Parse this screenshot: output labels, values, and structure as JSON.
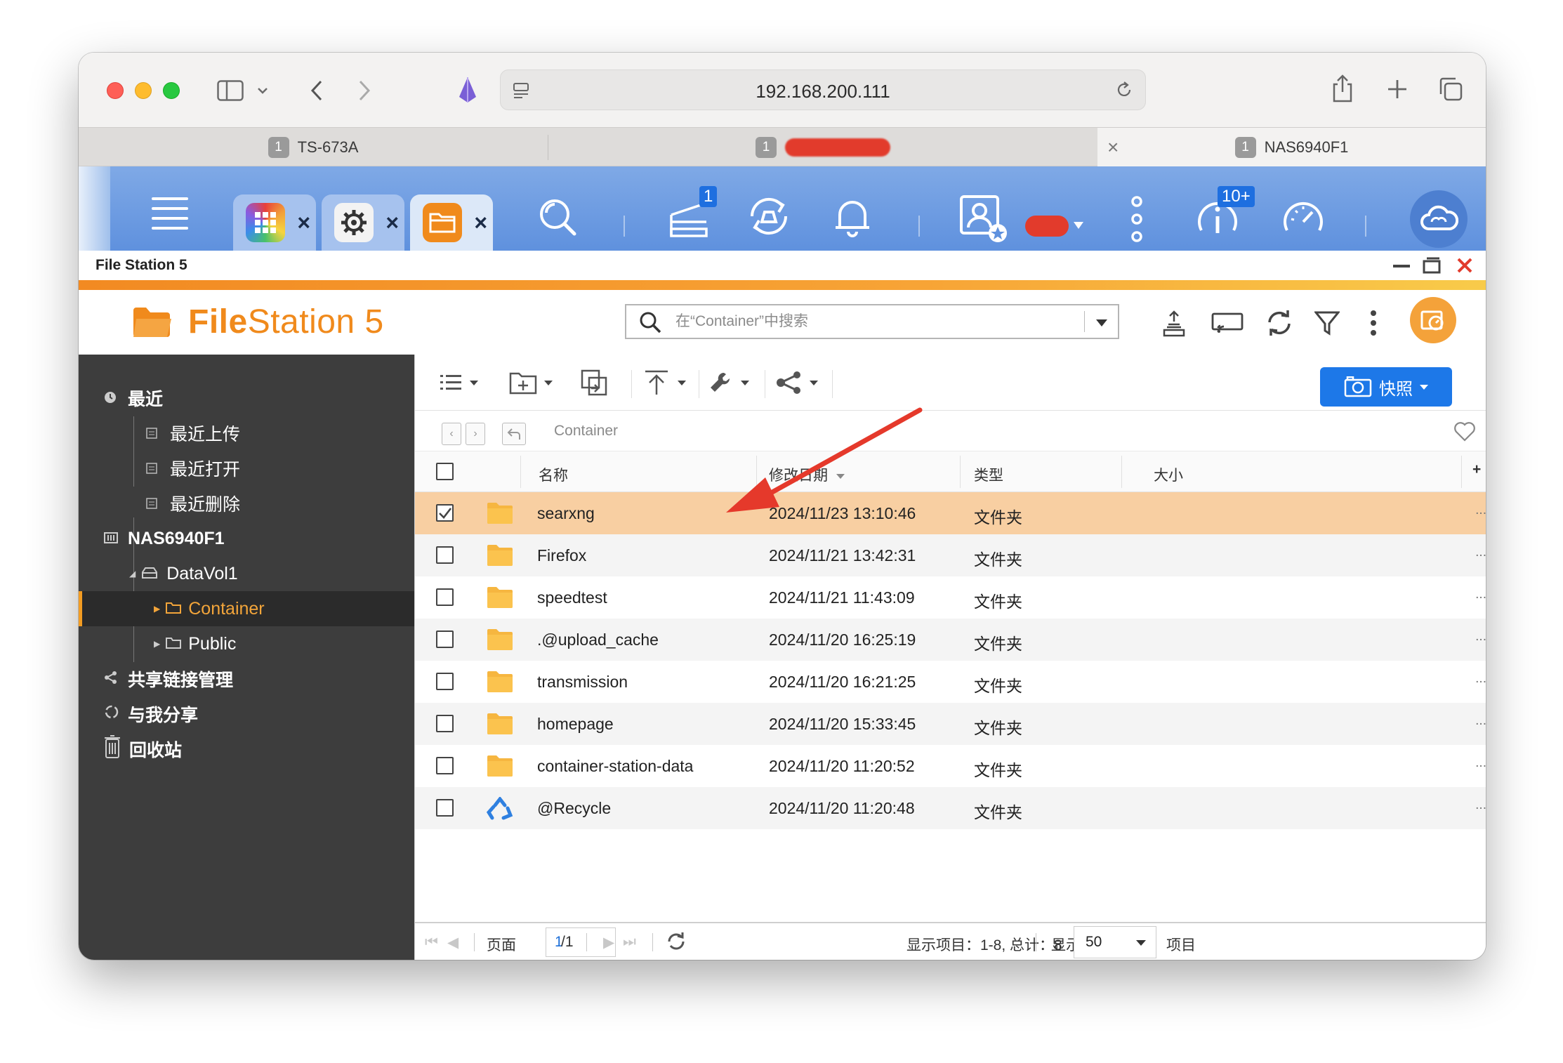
{
  "browser": {
    "address": "192.168.200.111",
    "tabs": [
      {
        "badge": "1",
        "label": "TS-673A"
      },
      {
        "badge": "1",
        "label": ""
      },
      {
        "badge": "1",
        "label": "NAS6940F1"
      }
    ],
    "tab_close": "×"
  },
  "qts": {
    "badge_tasks": "1",
    "badge_notifications": "10+"
  },
  "window": {
    "title": "File Station 5"
  },
  "app": {
    "logo_bold": "File",
    "logo_rest": "Station 5",
    "search_placeholder": "在“Container”中搜索",
    "snapshot_label": "快照"
  },
  "sidebar": {
    "recent": "最近",
    "recent_upload": "最近上传",
    "recent_open": "最近打开",
    "recent_delete": "最近删除",
    "nas": "NAS6940F1",
    "volume": "DataVol1",
    "folder_container": "Container",
    "folder_public": "Public",
    "share_links": "共享链接管理",
    "shared_with_me": "与我分享",
    "recycle_bin": "回收站"
  },
  "breadcrumb": {
    "path": "Container"
  },
  "table": {
    "columns": {
      "name": "名称",
      "modified": "修改日期",
      "type": "类型",
      "size": "大小",
      "add": "+"
    },
    "rows": [
      {
        "name": "searxng",
        "modified": "2024/11/23 13:10:46",
        "type": "文件夹",
        "more": "...",
        "checked": true
      },
      {
        "name": "Firefox",
        "modified": "2024/11/21 13:42:31",
        "type": "文件夹",
        "more": "..."
      },
      {
        "name": "speedtest",
        "modified": "2024/11/21 11:43:09",
        "type": "文件夹",
        "more": "..."
      },
      {
        "name": ".@upload_cache",
        "modified": "2024/11/20 16:25:19",
        "type": "文件夹",
        "more": "..."
      },
      {
        "name": "transmission",
        "modified": "2024/11/20 16:21:25",
        "type": "文件夹",
        "more": "..."
      },
      {
        "name": "homepage",
        "modified": "2024/11/20 15:33:45",
        "type": "文件夹",
        "more": "..."
      },
      {
        "name": "container-station-data",
        "modified": "2024/11/20 11:20:52",
        "type": "文件夹",
        "more": "..."
      },
      {
        "name": "@Recycle",
        "modified": "2024/11/20 11:20:48",
        "type": "文件夹",
        "more": "...",
        "icon": "recycle-icon"
      }
    ]
  },
  "footer": {
    "page_label": "页面",
    "page_value": "1",
    "page_total": "/1",
    "items_label": "显示项目：1-8, 总计：8",
    "show_label": "显示",
    "per_page": "50",
    "items_suffix": "项目"
  },
  "colors": {
    "accent_orange": "#f08a1c",
    "selected_row": "#f8cfa2",
    "snapshot_blue": "#1d78e8",
    "annotation_arrow": "#e5392b"
  }
}
